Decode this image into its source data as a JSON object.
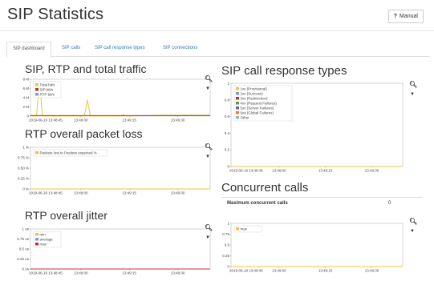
{
  "header": {
    "title": "SIP Statistics",
    "manual_label": "Manual",
    "manual_icon": "question-icon"
  },
  "tabs": [
    {
      "label": "SIP dashboard",
      "active": true
    },
    {
      "label": "SIP calls",
      "active": false
    },
    {
      "label": "SIP call response types",
      "active": false
    },
    {
      "label": "SIP connections",
      "active": false
    }
  ],
  "sections": {
    "traffic": "SIP, RTP and total traffic",
    "packet_loss": "RTP overall packet loss",
    "jitter": "RTP overall jitter",
    "response_types": "SIP call response types",
    "concurrent": "Concurrent calls"
  },
  "concurrent_table": {
    "label": "Maximum concurrent calls",
    "value": "0"
  },
  "icons": {
    "zoom": "magnifier-icon",
    "menu": "caret-down-icon"
  },
  "colors": {
    "yellow": "#f0c040",
    "blue": "#7aa0d8",
    "red": "#c83030",
    "axis": "#999999"
  },
  "chart_data": [
    {
      "id": "traffic",
      "type": "line",
      "x_ticks": [
        "2019-06-19 13:48:45",
        "13:49:00",
        "13:49:15",
        "13:49:30"
      ],
      "y_ticks": [
        "8 M",
        "6 M",
        "4 M",
        "2 M",
        "0"
      ],
      "ylim": [
        0,
        8
      ],
      "legend": [
        "Total bit/s",
        "SIP bit/s",
        "RTP bit/s"
      ],
      "series": [
        {
          "name": "Total bit/s",
          "color": "#f0c040",
          "x": [
            0,
            2,
            3,
            4,
            18,
            19,
            20,
            30,
            31,
            32,
            45,
            60
          ],
          "y": [
            0,
            0,
            7.6,
            0,
            0,
            3.5,
            0,
            0,
            0.3,
            0,
            0.2,
            0.2
          ]
        },
        {
          "name": "RTP bit/s",
          "color": "#c83030",
          "x": [
            0,
            60
          ],
          "y": [
            0.1,
            0.1
          ]
        }
      ]
    },
    {
      "id": "packet_loss",
      "type": "line",
      "x_ticks": [
        "2019-06-19 13:48:45",
        "13:49:00",
        "13:49:15",
        "13:49:30"
      ],
      "y_ticks": [
        "1 %",
        "0.75 %",
        "0.50 %",
        "0.25 %",
        "0 %"
      ],
      "ylim": [
        0,
        1
      ],
      "legend": [
        "Packets lost to Packets expected %"
      ],
      "series": [
        {
          "name": "Packets lost to Packets expected %",
          "color": "#f0c040",
          "x": [
            0,
            60
          ],
          "y": [
            0,
            0
          ]
        }
      ]
    },
    {
      "id": "jitter",
      "type": "line",
      "x_ticks": [
        "2019-06-19 13:48:45",
        "13:49:00",
        "13:49:15",
        "13:49:30"
      ],
      "y_ticks": [
        "1 us",
        "0.75 us",
        "0.5 us",
        "0.25 us",
        "0 us"
      ],
      "ylim": [
        0,
        1
      ],
      "legend": [
        "min",
        "average",
        "max"
      ],
      "series": [
        {
          "name": "min",
          "color": "#f0c040",
          "x": [
            0,
            60
          ],
          "y": [
            0,
            0
          ]
        },
        {
          "name": "average",
          "color": "#7aa0d8",
          "x": [
            0,
            60
          ],
          "y": [
            0,
            0
          ]
        },
        {
          "name": "max",
          "color": "#c83030",
          "x": [
            0,
            60
          ],
          "y": [
            0,
            0
          ]
        }
      ]
    },
    {
      "id": "response_types",
      "type": "line",
      "x_ticks": [
        "2019-06-19 13:48:45",
        "13:49:00",
        "13:49:15",
        "13:49:30"
      ],
      "y_ticks": [
        "1",
        "0.8",
        "0.6",
        "0.4",
        "0.2",
        "0"
      ],
      "ylim": [
        0,
        1
      ],
      "legend": [
        "1xx (Provisional)",
        "2xx (Success)",
        "3xx (Redirection)",
        "4xx (Request Failures)",
        "5xx (Server Failures)",
        "6xx (Global Failures)",
        "Other"
      ],
      "legend_colors": [
        "#f0c040",
        "#7aa0d8",
        "#c83030",
        "#50a050",
        "#9050a0",
        "#e08030",
        "#9ab0d8"
      ],
      "series": [
        {
          "name": "1xx (Provisional)",
          "color": "#f0c040",
          "x": [
            0,
            60
          ],
          "y": [
            0,
            0
          ]
        }
      ]
    },
    {
      "id": "concurrent",
      "type": "line",
      "x_ticks": [
        "2019-06-19 13:48:45",
        "13:49:00",
        "13:49:15",
        "13:49:30"
      ],
      "y_ticks": [
        "1",
        "0.75",
        "0.5",
        "0.25",
        "0"
      ],
      "ylim": [
        0,
        1
      ],
      "legend": [
        "max"
      ],
      "series": [
        {
          "name": "max",
          "color": "#f0c040",
          "x": [
            0,
            60
          ],
          "y": [
            0,
            0
          ]
        }
      ]
    }
  ]
}
